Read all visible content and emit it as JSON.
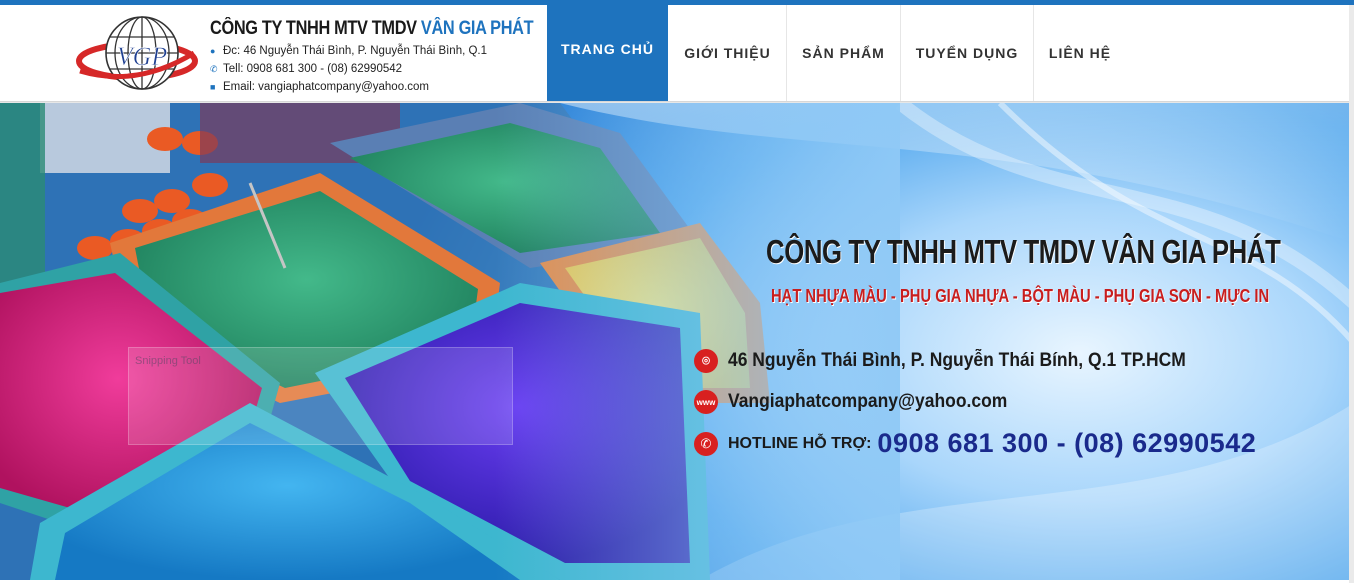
{
  "header": {
    "logo_text": "VGP",
    "company_name_prefix": "CÔNG TY TNHH MTV TMDV ",
    "company_name_accent": "VÂN GIA PHÁT",
    "address": "Đc: 46 Nguyễn Thái Bình, P. Nguyễn Thái Bình, Q.1",
    "phone": "Tell: 0908 681 300 - (08) 62990542",
    "email": "Email: vangiaphatcompany@yahoo.com",
    "icons": [
      "map-pin-icon",
      "phone-icon",
      "mail-icon"
    ]
  },
  "nav": {
    "items": [
      {
        "label": "TRANG CHỦ",
        "active": true
      },
      {
        "label": "GIỚI THIỆU",
        "active": false
      },
      {
        "label": "SẢN PHẨM",
        "active": false
      },
      {
        "label": "TUYỂN DỤNG",
        "active": false
      },
      {
        "label": "LIÊN HỆ",
        "active": false
      }
    ]
  },
  "banner": {
    "title": "CÔNG TY TNHH MTV TMDV VÂN GIA PHÁT",
    "subtitle": "HẠT NHỰA MÀU - PHỤ GIA NHỰA - BỘT MÀU - PHỤ GIA SƠN - MỰC IN",
    "address": "46 Nguyễn Thái Bình, P. Nguyễn Thái Bính, Q.1 TP.HCM",
    "email": "Vangiaphatcompany@yahoo.com",
    "hotline_label": "HOTLINE HỖ TRỢ:",
    "hotline_numbers": "0908 681 300 - (08) 62990542",
    "icons": [
      "map-pin-icon",
      "www-icon",
      "phone-icon"
    ]
  },
  "overlay": {
    "label": "Snipping Tool"
  },
  "colors": {
    "primary": "#1e73be",
    "banner_red": "#c81e1e",
    "hotline_blue": "#1a2a8c"
  }
}
